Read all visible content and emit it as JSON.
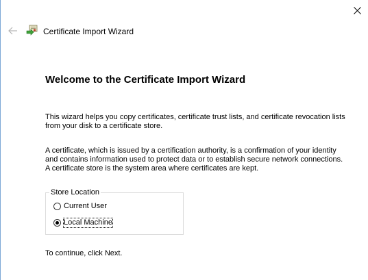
{
  "window": {
    "title": "Certificate Import Wizard",
    "close_icon": "close-icon",
    "back_icon": "back-arrow-icon",
    "app_icon": "certificate-wizard-icon"
  },
  "content": {
    "heading": "Welcome to the Certificate Import Wizard",
    "intro": "This wizard helps you copy certificates, certificate trust lists, and certificate revocation lists from your disk to a certificate store.",
    "description": "A certificate, which is issued by a certification authority, is a confirmation of your identity and contains information used to protect data or to establish secure network connections. A certificate store is the system area where certificates are kept.",
    "store_location": {
      "label": "Store Location",
      "options": [
        {
          "label": "Current User",
          "checked": false
        },
        {
          "label": "Local Machine",
          "checked": true
        }
      ]
    },
    "continue_text": "To continue, click Next."
  },
  "colors": {
    "window_edge": "#7aa7d6",
    "group_border": "#dcdcdc"
  }
}
